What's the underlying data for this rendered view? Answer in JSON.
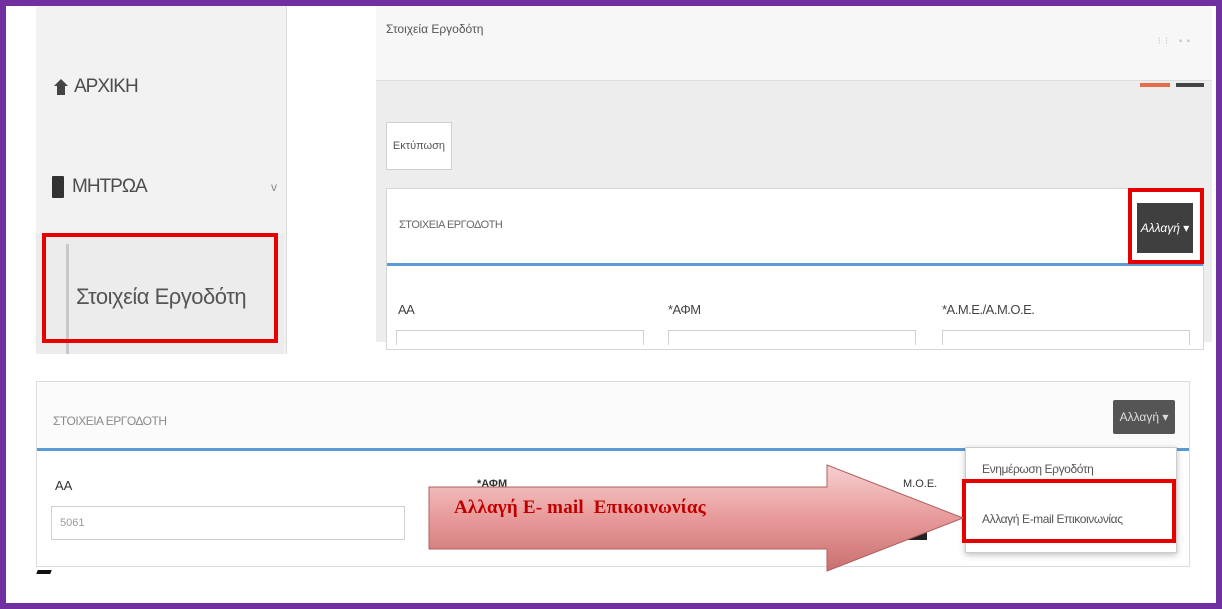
{
  "sidebar": {
    "home_label": "ΑΡΧΙΚΗ",
    "registers_label": "ΜΗΤΡΩΑ",
    "registers_chevron": "v",
    "employer_details_label": "Στοιχεία Εργοδότη"
  },
  "panel": {
    "header_title": "Στοιχεία Εργοδότη",
    "tools_glyphs": "⁝⁝ ▪▪",
    "print_label": "Εκτύπωση",
    "form_title": "ΣΤΟΙΧΕΙΑ ΕΡΓΟΔΟΤΗ",
    "change_button": "Αλλαγή ▾",
    "field_aa": "ΑΑ",
    "field_afm": "*ΑΦΜ",
    "field_ame": "*Α.Μ.Ε./Α.Μ.Ο.Ε."
  },
  "bottom": {
    "form_title": "ΣΤΟΙΧΕΙΑ ΕΡΓΟΔΟΤΗ",
    "change_button": "Αλλαγή ▾",
    "field_aa": "ΑΑ",
    "aa_value": "5061",
    "field_afm": "*ΑΦΜ",
    "field_ame": "Μ.Ο.Ε.",
    "menu": [
      "Ενημέρωση Εργοδότη",
      "Αλλαγή E-mail Επικοινωνίας"
    ]
  },
  "callout_text": "Αλλαγή E- mail  Επικοινωνίας",
  "colors": {
    "frame": "#7030a0",
    "highlight": "#e60000",
    "accent_line": "#5b9bd5",
    "arrow_fill": "#e89a9a",
    "callout_text": "#c00000"
  }
}
